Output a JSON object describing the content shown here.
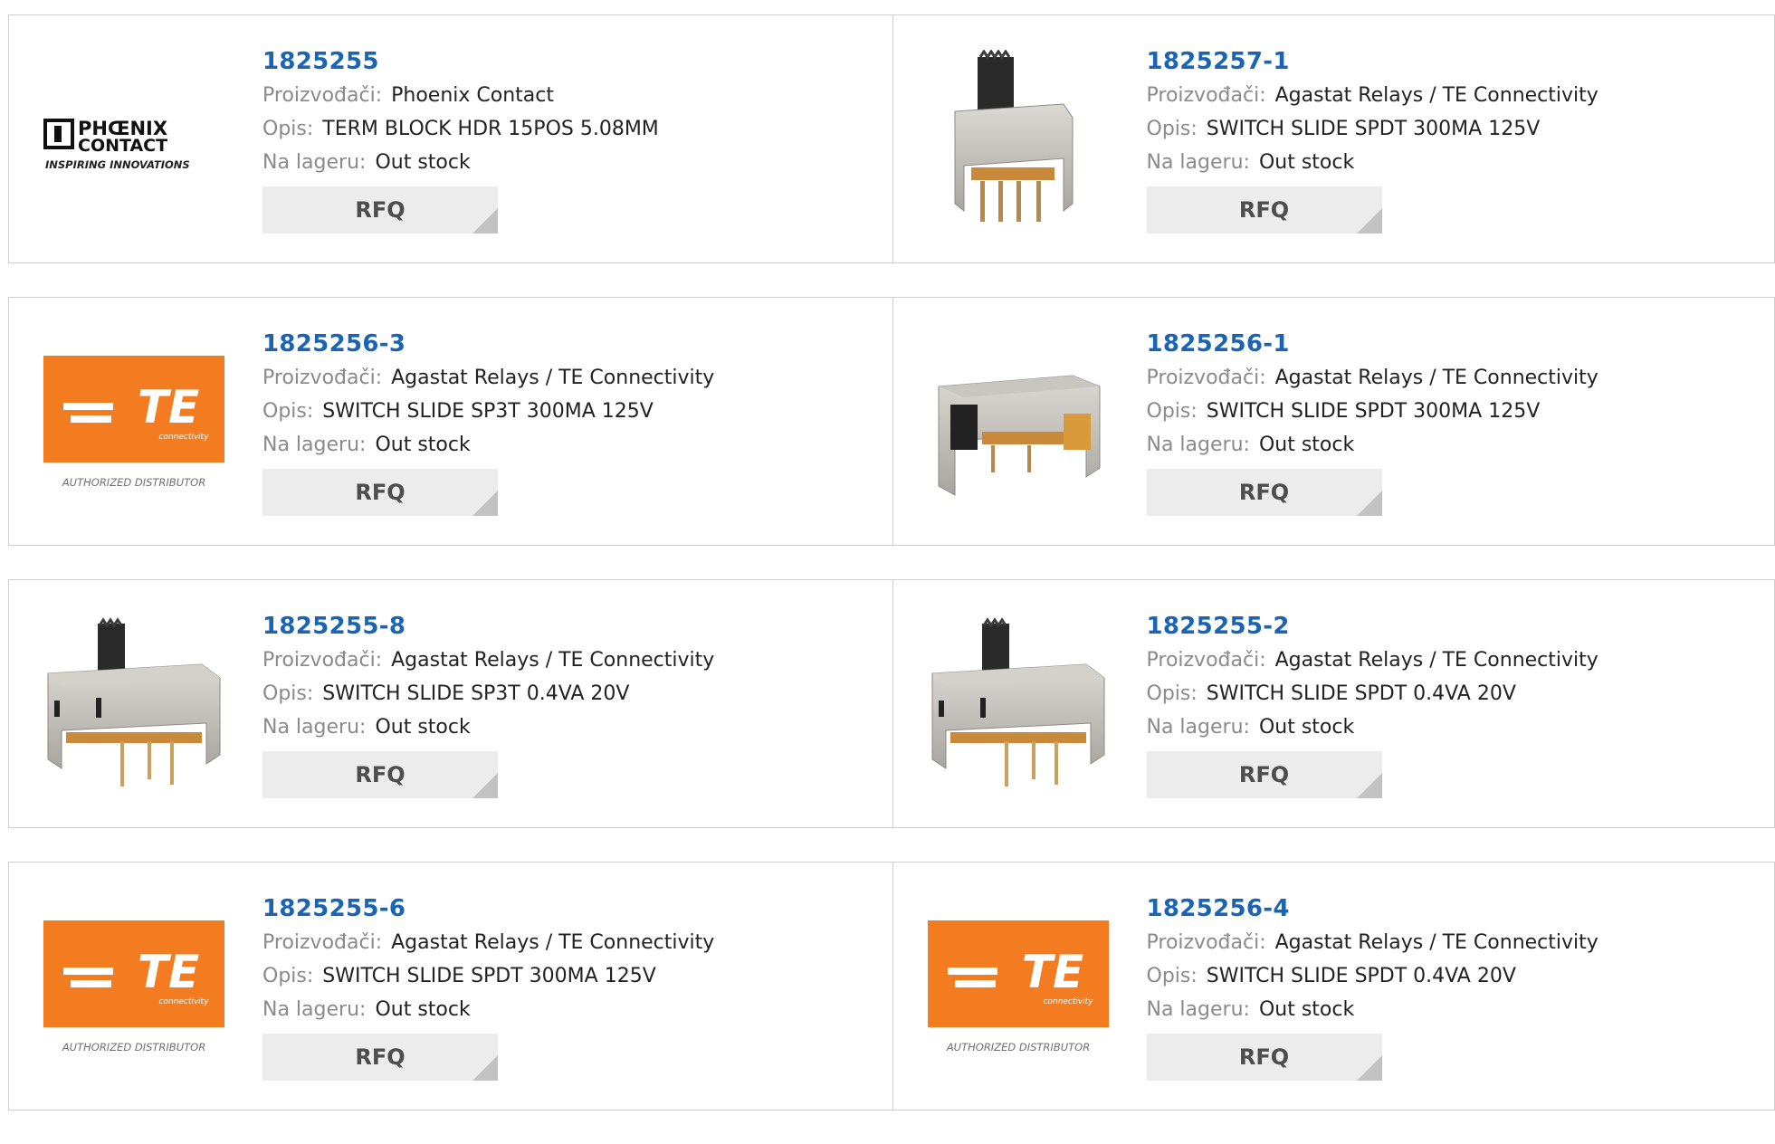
{
  "labels": {
    "manufacturer": "Proizvođači:",
    "description": "Opis:",
    "stock": "Na lageru:"
  },
  "rfq_label": "RFQ",
  "products": [
    {
      "part": "1825255",
      "manufacturer": "Phoenix Contact",
      "description": "TERM BLOCK HDR 15POS 5.08MM",
      "stock": "Out stock",
      "image": "phoenix-logo",
      "logo": {
        "line1": "PHŒNIX",
        "line2": "CONTACT",
        "tagline": "INSPIRING INNOVATIONS"
      }
    },
    {
      "part": "1825257-1",
      "manufacturer": "Agastat Relays / TE Connectivity",
      "description": "SWITCH SLIDE SPDT 300MA 125V",
      "stock": "Out stock",
      "image": "switch-vertical"
    },
    {
      "part": "1825256-3",
      "manufacturer": "Agastat Relays / TE Connectivity",
      "description": "SWITCH SLIDE SP3T 300MA 125V",
      "stock": "Out stock",
      "image": "te-logo",
      "logo": {
        "mark": "TE",
        "sub": "connectivity",
        "tagline": "AUTHORIZED DISTRIBUTOR"
      }
    },
    {
      "part": "1825256-1",
      "manufacturer": "Agastat Relays / TE Connectivity",
      "description": "SWITCH SLIDE SPDT 300MA 125V",
      "stock": "Out stock",
      "image": "switch-side"
    },
    {
      "part": "1825255-8",
      "manufacturer": "Agastat Relays / TE Connectivity",
      "description": "SWITCH SLIDE SP3T 0.4VA 20V",
      "stock": "Out stock",
      "image": "switch-horizontal"
    },
    {
      "part": "1825255-2",
      "manufacturer": "Agastat Relays / TE Connectivity",
      "description": "SWITCH SLIDE SPDT 0.4VA 20V",
      "stock": "Out stock",
      "image": "switch-horizontal"
    },
    {
      "part": "1825255-6",
      "manufacturer": "Agastat Relays / TE Connectivity",
      "description": "SWITCH SLIDE SPDT 300MA 125V",
      "stock": "Out stock",
      "image": "te-logo",
      "logo": {
        "mark": "TE",
        "sub": "connectivity",
        "tagline": "AUTHORIZED DISTRIBUTOR"
      }
    },
    {
      "part": "1825256-4",
      "manufacturer": "Agastat Relays / TE Connectivity",
      "description": "SWITCH SLIDE SPDT 0.4VA 20V",
      "stock": "Out stock",
      "image": "te-logo",
      "logo": {
        "mark": "TE",
        "sub": "connectivity",
        "tagline": "AUTHORIZED DISTRIBUTOR"
      }
    }
  ],
  "colors": {
    "part_number": "#1b64b4",
    "te_orange": "#f47c20",
    "rfq_bg": "#ececec"
  }
}
